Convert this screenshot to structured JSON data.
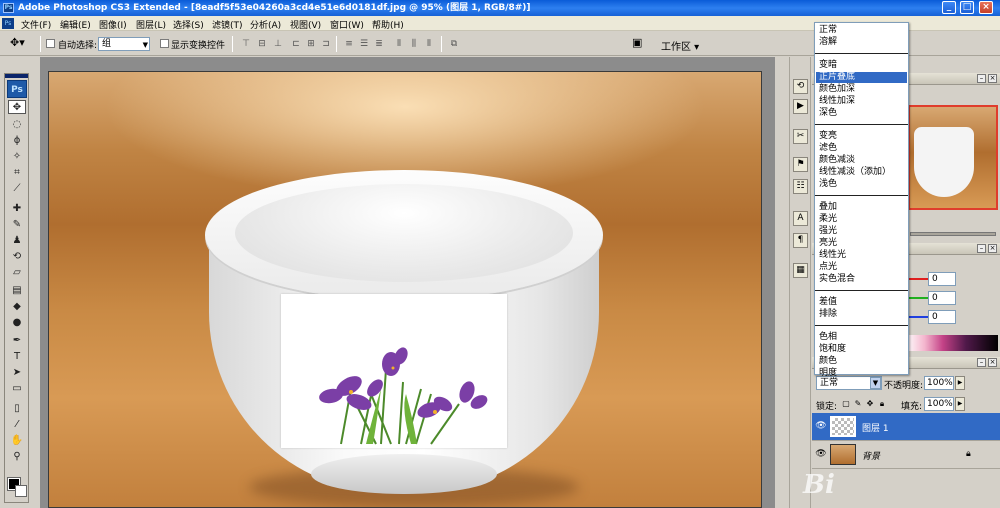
{
  "window": {
    "title": "Adobe Photoshop CS3 Extended - [8eadf5f53e04260a3cd4e51e6d0181df.jpg @ 95% (图层 1, RGB/8#)]",
    "logo_text": "Ps",
    "buttons": {
      "minimize": "_",
      "maximize": "□",
      "close": "×"
    }
  },
  "menu": {
    "items": [
      "文件(F)",
      "编辑(E)",
      "图像(I)",
      "图层(L)",
      "选择(S)",
      "滤镜(T)",
      "分析(A)",
      "视图(V)",
      "窗口(W)",
      "帮助(H)"
    ]
  },
  "options": {
    "auto_select_label": "自动选择:",
    "auto_select_value": "组",
    "show_transform_label": "显示变换控件",
    "workspace_label": "工作区 ▾"
  },
  "toolbox": {
    "logo": "Ps",
    "tools": [
      {
        "name": "move",
        "glyph": "✥"
      },
      {
        "name": "marquee",
        "glyph": "◌"
      },
      {
        "name": "lasso",
        "glyph": "ϕ"
      },
      {
        "name": "magic-wand",
        "glyph": "✧"
      },
      {
        "name": "crop",
        "glyph": "⌗"
      },
      {
        "name": "slice",
        "glyph": "⟋"
      },
      {
        "name": "healing",
        "glyph": "✚"
      },
      {
        "name": "brush",
        "glyph": "✎"
      },
      {
        "name": "clone-stamp",
        "glyph": "♟"
      },
      {
        "name": "history-brush",
        "glyph": "⟲"
      },
      {
        "name": "eraser",
        "glyph": "▱"
      },
      {
        "name": "gradient",
        "glyph": "▤"
      },
      {
        "name": "blur",
        "glyph": "◆"
      },
      {
        "name": "dodge",
        "glyph": "●"
      },
      {
        "name": "pen",
        "glyph": "✒"
      },
      {
        "name": "type",
        "glyph": "T"
      },
      {
        "name": "path-select",
        "glyph": "➤"
      },
      {
        "name": "shape",
        "glyph": "▭"
      },
      {
        "name": "notes",
        "glyph": "▯"
      },
      {
        "name": "eyedropper",
        "glyph": "⁄"
      },
      {
        "name": "hand",
        "glyph": "✋"
      },
      {
        "name": "zoom",
        "glyph": "⚲"
      }
    ]
  },
  "dock": {
    "icons": [
      "history",
      "actions",
      "tools-preset",
      "clone-source",
      "layer-comps",
      "character",
      "paragraph",
      "brushes"
    ]
  },
  "color_panel": {
    "r": "0",
    "g": "0",
    "b": "0",
    "colors": {
      "r": "#e02020",
      "g": "#20b020",
      "b": "#2040e0"
    }
  },
  "blend_menu": {
    "selected": "正片叠底",
    "groups": [
      [
        "正常",
        "溶解"
      ],
      [
        "变暗",
        "正片叠底",
        "颜色加深",
        "线性加深",
        "深色"
      ],
      [
        "变亮",
        "滤色",
        "颜色减淡",
        "线性减淡（添加）",
        "浅色"
      ],
      [
        "叠加",
        "柔光",
        "强光",
        "亮光",
        "线性光",
        "点光",
        "实色混合"
      ],
      [
        "差值",
        "排除"
      ],
      [
        "色相",
        "饱和度",
        "颜色",
        "明度"
      ]
    ]
  },
  "layers_panel": {
    "blend_value": "正常",
    "opacity_label": "不透明度:",
    "opacity_value": "100%",
    "lock_label": "锁定:",
    "fill_label": "填充:",
    "fill_value": "100%",
    "layers": [
      {
        "name": "图层 1",
        "selected": true,
        "locked": false
      },
      {
        "name": "背景",
        "selected": false,
        "locked": true
      }
    ]
  },
  "watermark": "Bi",
  "colors": {
    "selection": "#316ac5",
    "title_bar": "#0a5bd8",
    "nav_frame": "#e03c2c"
  }
}
